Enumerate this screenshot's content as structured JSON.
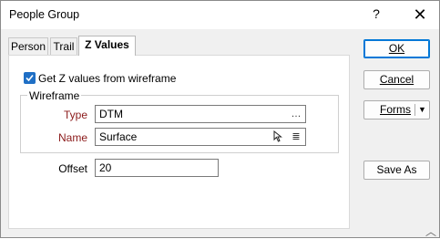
{
  "window": {
    "title": "People Group"
  },
  "titlebar": {
    "help_label": "?",
    "close_label": "✕"
  },
  "tabs": [
    {
      "label": "Person"
    },
    {
      "label": "Trail"
    },
    {
      "label": "Z Values"
    }
  ],
  "zvalues": {
    "checkbox_label": "Get Z values from wireframe",
    "checkbox_checked": true,
    "group_label": "Wireframe",
    "type_label": "Type",
    "type_value": "DTM",
    "name_label": "Name",
    "name_value": "Surface",
    "offset_label": "Offset",
    "offset_value": "20"
  },
  "buttons": {
    "ok": "OK",
    "cancel": "Cancel",
    "forms": "Forms",
    "save_as": "Save As"
  }
}
